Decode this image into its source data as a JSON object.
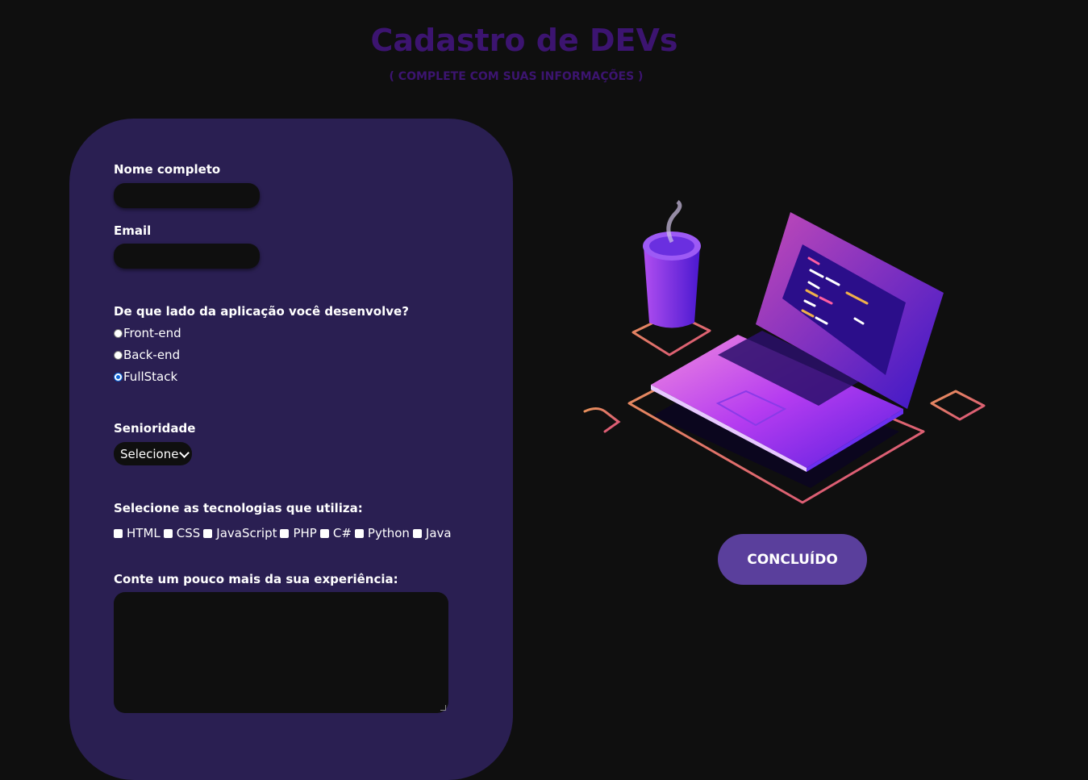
{
  "header": {
    "title": "Cadastro de DEVs",
    "subtitle": "( COMPLETE COM SUAS INFORMAÇÕES )"
  },
  "form": {
    "name_label": "Nome completo",
    "name_value": "",
    "email_label": "Email",
    "email_value": "",
    "side_question": "De que lado da aplicação você desenvolve?",
    "side_options": [
      "Front-end",
      "Back-end",
      "FullStack"
    ],
    "side_selected": "FullStack",
    "seniority_label": "Senioridade",
    "seniority_selected": "Selecione",
    "tech_label": "Selecione as tecnologias que utiliza:",
    "tech_options": [
      "HTML",
      "CSS",
      "JavaScript",
      "PHP",
      "C#",
      "Python",
      "Java"
    ],
    "experience_label": "Conte um pouco mais da sua experiência:",
    "experience_value": ""
  },
  "submit_label": "CONCLUÍDO",
  "colors": {
    "background": "#0f0f0f",
    "panel": "#2a1f52",
    "title": "#3c1470",
    "button": "#5a3f9c",
    "radio_checked": "#0a62d6"
  }
}
